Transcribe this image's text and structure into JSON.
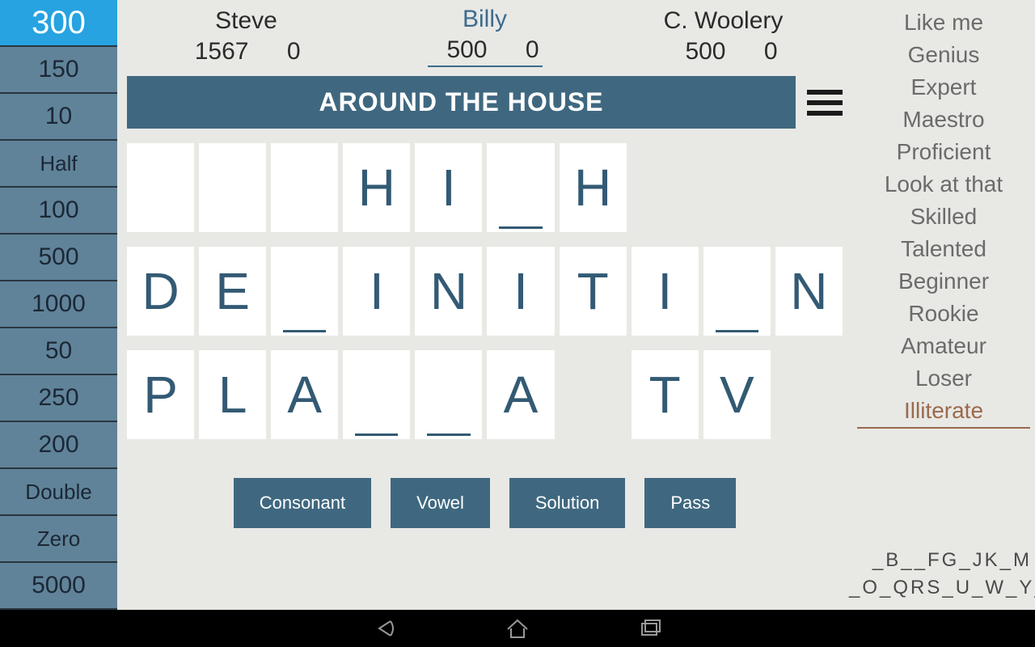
{
  "wheel": {
    "items": [
      {
        "label": "300",
        "active": true,
        "small": false
      },
      {
        "label": "150",
        "active": false,
        "small": false
      },
      {
        "label": "10",
        "active": false,
        "small": false
      },
      {
        "label": "Half",
        "active": false,
        "small": true
      },
      {
        "label": "100",
        "active": false,
        "small": false
      },
      {
        "label": "500",
        "active": false,
        "small": false
      },
      {
        "label": "1000",
        "active": false,
        "small": false
      },
      {
        "label": "50",
        "active": false,
        "small": false
      },
      {
        "label": "250",
        "active": false,
        "small": false
      },
      {
        "label": "200",
        "active": false,
        "small": false
      },
      {
        "label": "Double",
        "active": false,
        "small": true
      },
      {
        "label": "Zero",
        "active": false,
        "small": true
      },
      {
        "label": "5000",
        "active": false,
        "small": false
      }
    ]
  },
  "players": [
    {
      "name": "Steve",
      "total": "1567",
      "round": "0",
      "active": false
    },
    {
      "name": "Billy",
      "total": "500",
      "round": "0",
      "active": true
    },
    {
      "name": "C. Woolery",
      "total": "500",
      "round": "0",
      "active": false
    }
  ],
  "category": "AROUND THE HOUSE",
  "board": {
    "rows": [
      [
        {
          "ch": "",
          "blank": false,
          "u": false
        },
        {
          "ch": "",
          "blank": false,
          "u": false
        },
        {
          "ch": "",
          "blank": false,
          "u": false
        },
        {
          "ch": "H",
          "blank": false,
          "u": false
        },
        {
          "ch": "I",
          "blank": false,
          "u": false
        },
        {
          "ch": "",
          "blank": false,
          "u": true
        },
        {
          "ch": "H",
          "blank": false,
          "u": false
        },
        {
          "ch": "",
          "blank": true,
          "u": false
        },
        {
          "ch": "",
          "blank": true,
          "u": false
        },
        {
          "ch": "",
          "blank": true,
          "u": false
        }
      ],
      [
        {
          "ch": "D",
          "blank": false,
          "u": false
        },
        {
          "ch": "E",
          "blank": false,
          "u": false
        },
        {
          "ch": "",
          "blank": false,
          "u": true
        },
        {
          "ch": "I",
          "blank": false,
          "u": false
        },
        {
          "ch": "N",
          "blank": false,
          "u": false
        },
        {
          "ch": "I",
          "blank": false,
          "u": false
        },
        {
          "ch": "T",
          "blank": false,
          "u": false
        },
        {
          "ch": "I",
          "blank": false,
          "u": false
        },
        {
          "ch": "",
          "blank": false,
          "u": true
        },
        {
          "ch": "N",
          "blank": false,
          "u": false
        }
      ],
      [
        {
          "ch": "P",
          "blank": false,
          "u": false
        },
        {
          "ch": "L",
          "blank": false,
          "u": false
        },
        {
          "ch": "A",
          "blank": false,
          "u": false
        },
        {
          "ch": "",
          "blank": false,
          "u": true
        },
        {
          "ch": "",
          "blank": false,
          "u": true
        },
        {
          "ch": "A",
          "blank": false,
          "u": false
        },
        {
          "ch": "",
          "blank": true,
          "u": false
        },
        {
          "ch": "T",
          "blank": false,
          "u": false
        },
        {
          "ch": "V",
          "blank": false,
          "u": false
        },
        {
          "ch": "",
          "blank": true,
          "u": false
        }
      ]
    ]
  },
  "actions": {
    "consonant": "Consonant",
    "vowel": "Vowel",
    "solution": "Solution",
    "pass": "Pass"
  },
  "ranks": [
    "Like me",
    "Genius",
    "Expert",
    "Maestro",
    "Proficient",
    "Look at that",
    "Skilled",
    "Talented",
    "Beginner",
    "Rookie",
    "Amateur",
    "Loser",
    "Illiterate"
  ],
  "rank_active_index": 12,
  "alpha": {
    "line1": "_B__FG_JK_M",
    "line2": "_O_QRS_U_W_Y_"
  }
}
